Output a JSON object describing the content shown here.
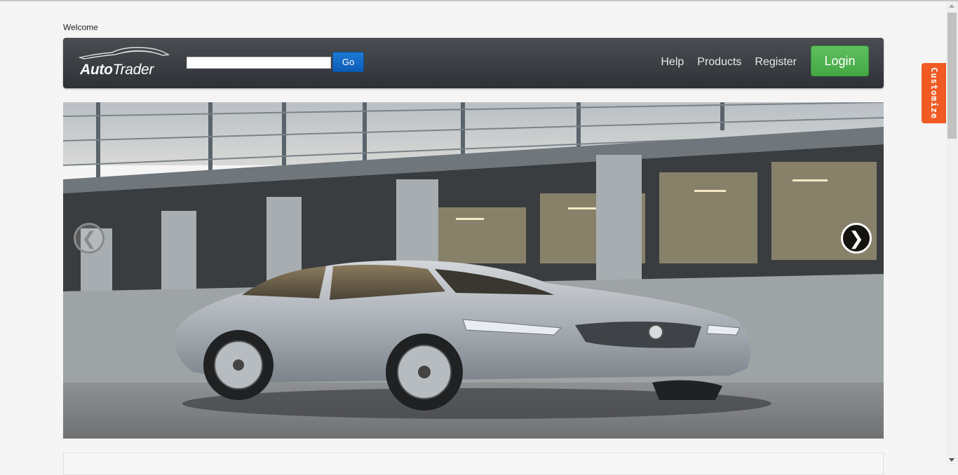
{
  "header": {
    "welcome_text": "Welcome"
  },
  "navbar": {
    "logo": {
      "text_bold": "Auto",
      "text_light": "Trader"
    },
    "search": {
      "value": "",
      "placeholder": ""
    },
    "go_label": "Go",
    "links": [
      "Help",
      "Products",
      "Register"
    ],
    "login_label": "Login"
  },
  "customize_tab": {
    "label": "Customize",
    "color": "#f15a22"
  },
  "carousel": {
    "prev_icon": "❮",
    "next_icon": "❯",
    "slide_subject": "silver-sedan-image"
  },
  "colors": {
    "navbar": "#3a3d41",
    "go_button": "#0b5bb5",
    "login_button": "#4cae4c",
    "background": "#f5f5f5"
  }
}
